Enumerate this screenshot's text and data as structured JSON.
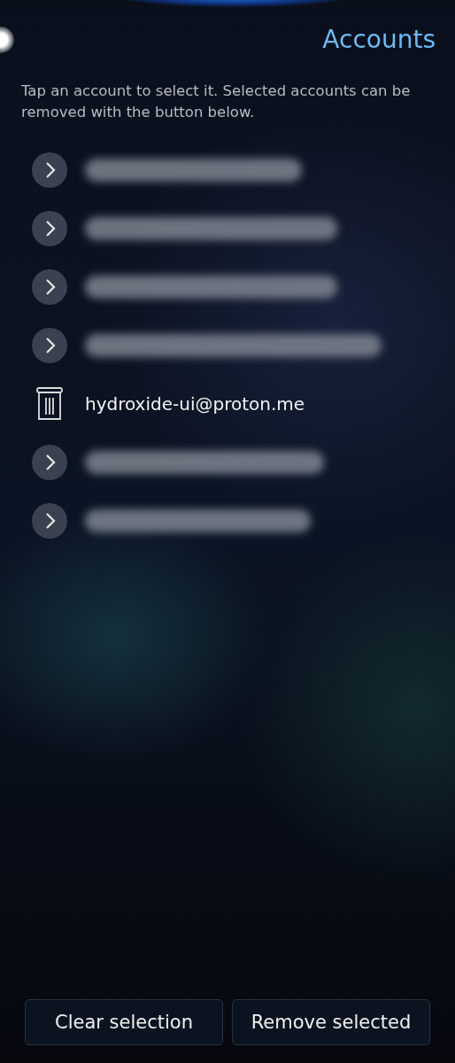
{
  "title": "Accounts",
  "description": "Tap an account to select it. Selected accounts can be removed with the button below.",
  "accounts": [
    {
      "selected": false,
      "blurred": true
    },
    {
      "selected": false,
      "blurred": true
    },
    {
      "selected": false,
      "blurred": true
    },
    {
      "selected": false,
      "blurred": true
    },
    {
      "address": "hydroxide-ui@proton.me",
      "selected": true,
      "blurred": false
    },
    {
      "selected": false,
      "blurred": true
    },
    {
      "selected": false,
      "blurred": true
    }
  ],
  "buttons": [
    "Clear selection",
    "Remove selected"
  ]
}
